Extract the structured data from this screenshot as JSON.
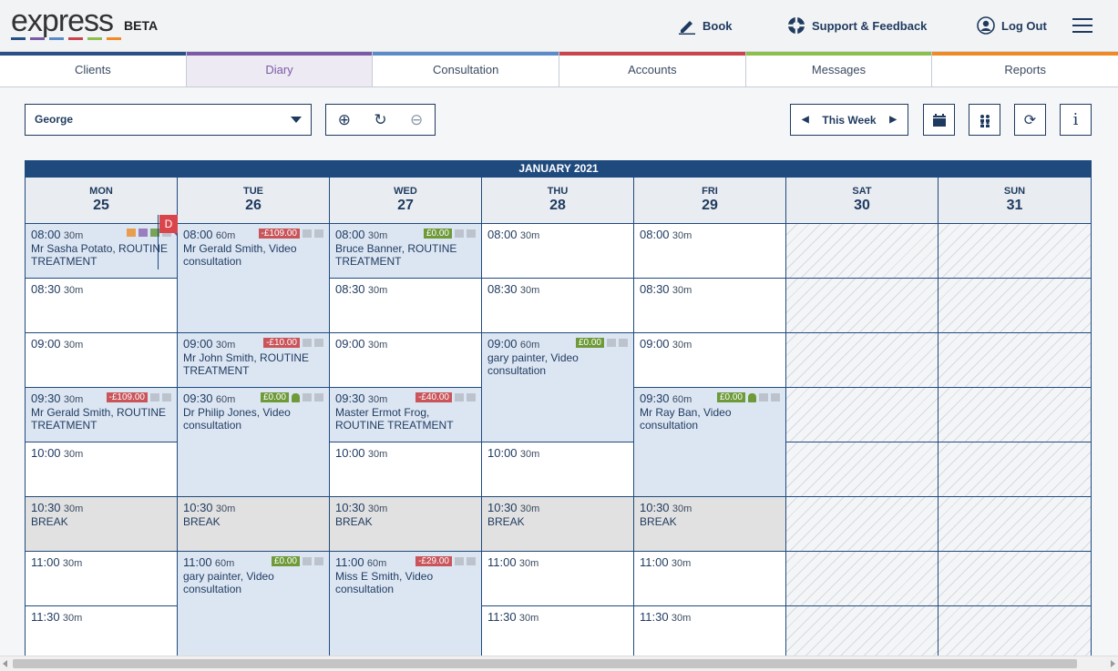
{
  "app": {
    "logo": "express",
    "logo_badge": "BETA",
    "logo_colors": [
      "#2a4f86",
      "#7a5aa6",
      "#5b8cc8",
      "#c9454b",
      "#8cbf4d",
      "#f08a24"
    ]
  },
  "header": {
    "book": "Book",
    "support": "Support & Feedback",
    "logout": "Log Out"
  },
  "tabs": [
    {
      "label": "Clients",
      "color": "#2a4f86"
    },
    {
      "label": "Diary",
      "color": "#7a5aa6"
    },
    {
      "label": "Consultation",
      "color": "#5b8cc8"
    },
    {
      "label": "Accounts",
      "color": "#c9454b"
    },
    {
      "label": "Messages",
      "color": "#8cbf4d"
    },
    {
      "label": "Reports",
      "color": "#f08a24"
    }
  ],
  "toolbar": {
    "practitioner": "George",
    "week_label": "This Week"
  },
  "calendar": {
    "month": "JANUARY 2021",
    "days": [
      {
        "name": "MON",
        "date": "25"
      },
      {
        "name": "TUE",
        "date": "26"
      },
      {
        "name": "WED",
        "date": "27"
      },
      {
        "name": "THU",
        "date": "28"
      },
      {
        "name": "FRI",
        "date": "29"
      },
      {
        "name": "SAT",
        "date": "30"
      },
      {
        "name": "SUN",
        "date": "31"
      }
    ],
    "slots": [
      {
        "day": 0,
        "row": 0,
        "span": 1,
        "time": "08:00",
        "dur": "30m",
        "type": "appt",
        "text": "Mr Sasha Potato, ROUTINE TREATMENT",
        "icons": [
          "c1",
          "c2",
          "c3",
          "g"
        ],
        "corner": true
      },
      {
        "day": 0,
        "row": 1,
        "span": 1,
        "time": "08:30",
        "dur": "30m",
        "type": "free",
        "dbadge": "D"
      },
      {
        "day": 0,
        "row": 2,
        "span": 1,
        "time": "09:00",
        "dur": "30m",
        "type": "free"
      },
      {
        "day": 0,
        "row": 3,
        "span": 1,
        "time": "09:30",
        "dur": "30m",
        "type": "appt",
        "text": "Mr Gerald Smith, ROUTINE TREATMENT",
        "price": "-£109.00",
        "priceType": "neg",
        "icons": [
          "g",
          "g"
        ]
      },
      {
        "day": 0,
        "row": 4,
        "span": 1,
        "time": "10:00",
        "dur": "30m",
        "type": "free"
      },
      {
        "day": 0,
        "row": 5,
        "span": 1,
        "time": "10:30",
        "dur": "30m",
        "type": "brk",
        "text": "BREAK"
      },
      {
        "day": 0,
        "row": 6,
        "span": 1,
        "time": "11:00",
        "dur": "30m",
        "type": "free"
      },
      {
        "day": 0,
        "row": 7,
        "span": 1,
        "time": "11:30",
        "dur": "30m",
        "type": "free"
      },
      {
        "day": 1,
        "row": 0,
        "span": 2,
        "time": "08:00",
        "dur": "60m",
        "type": "appt",
        "text": "Mr Gerald Smith, Video consultation",
        "price": "-£109.00",
        "priceType": "neg",
        "icons": [
          "g",
          "g"
        ]
      },
      {
        "day": 1,
        "row": 2,
        "span": 1,
        "time": "09:00",
        "dur": "30m",
        "type": "appt",
        "text": "Mr John Smith, ROUTINE TREATMENT",
        "price": "-£10.00",
        "priceType": "neg",
        "icons": [
          "g",
          "g"
        ]
      },
      {
        "day": 1,
        "row": 3,
        "span": 2,
        "time": "09:30",
        "dur": "60m",
        "type": "appt",
        "text": "Dr Philip Jones, Video consultation",
        "price": "£0.00",
        "priceType": "pos",
        "icons": [
          "p",
          "g",
          "g"
        ]
      },
      {
        "day": 1,
        "row": 5,
        "span": 1,
        "time": "10:30",
        "dur": "30m",
        "type": "brk",
        "text": "BREAK"
      },
      {
        "day": 1,
        "row": 6,
        "span": 2,
        "time": "11:00",
        "dur": "60m",
        "type": "appt",
        "text": "gary painter, Video consultation",
        "price": "£0.00",
        "priceType": "pos",
        "icons": [
          "g",
          "g"
        ]
      },
      {
        "day": 2,
        "row": 0,
        "span": 1,
        "time": "08:00",
        "dur": "30m",
        "type": "appt",
        "text": "Bruce Banner, ROUTINE TREATMENT",
        "price": "£0.00",
        "priceType": "pos",
        "icons": [
          "g",
          "g"
        ]
      },
      {
        "day": 2,
        "row": 1,
        "span": 1,
        "time": "08:30",
        "dur": "30m",
        "type": "free"
      },
      {
        "day": 2,
        "row": 2,
        "span": 1,
        "time": "09:00",
        "dur": "30m",
        "type": "free"
      },
      {
        "day": 2,
        "row": 3,
        "span": 1,
        "time": "09:30",
        "dur": "30m",
        "type": "appt",
        "text": "Master Ermot Frog, ROUTINE TREATMENT",
        "price": "-£40.00",
        "priceType": "neg",
        "icons": [
          "g",
          "g"
        ]
      },
      {
        "day": 2,
        "row": 4,
        "span": 1,
        "time": "10:00",
        "dur": "30m",
        "type": "free"
      },
      {
        "day": 2,
        "row": 5,
        "span": 1,
        "time": "10:30",
        "dur": "30m",
        "type": "brk",
        "text": "BREAK"
      },
      {
        "day": 2,
        "row": 6,
        "span": 2,
        "time": "11:00",
        "dur": "60m",
        "type": "appt",
        "text": "Miss E Smith, Video consultation",
        "price": "-£29.00",
        "priceType": "neg",
        "icons": [
          "g",
          "g"
        ]
      },
      {
        "day": 3,
        "row": 0,
        "span": 1,
        "time": "08:00",
        "dur": "30m",
        "type": "free"
      },
      {
        "day": 3,
        "row": 1,
        "span": 1,
        "time": "08:30",
        "dur": "30m",
        "type": "free"
      },
      {
        "day": 3,
        "row": 2,
        "span": 2,
        "time": "09:00",
        "dur": "60m",
        "type": "appt",
        "text": "gary painter, Video consultation",
        "price": "£0.00",
        "priceType": "pos",
        "icons": [
          "g",
          "g"
        ]
      },
      {
        "day": 3,
        "row": 4,
        "span": 1,
        "time": "10:00",
        "dur": "30m",
        "type": "free"
      },
      {
        "day": 3,
        "row": 5,
        "span": 1,
        "time": "10:30",
        "dur": "30m",
        "type": "brk",
        "text": "BREAK"
      },
      {
        "day": 3,
        "row": 6,
        "span": 1,
        "time": "11:00",
        "dur": "30m",
        "type": "free"
      },
      {
        "day": 3,
        "row": 7,
        "span": 1,
        "time": "11:30",
        "dur": "30m",
        "type": "free"
      },
      {
        "day": 4,
        "row": 0,
        "span": 1,
        "time": "08:00",
        "dur": "30m",
        "type": "free"
      },
      {
        "day": 4,
        "row": 1,
        "span": 1,
        "time": "08:30",
        "dur": "30m",
        "type": "free"
      },
      {
        "day": 4,
        "row": 2,
        "span": 1,
        "time": "09:00",
        "dur": "30m",
        "type": "free"
      },
      {
        "day": 4,
        "row": 3,
        "span": 2,
        "time": "09:30",
        "dur": "60m",
        "type": "appt",
        "text": "Mr Ray Ban, Video consultation",
        "price": "£0.00",
        "priceType": "pos",
        "icons": [
          "p",
          "g",
          "g"
        ]
      },
      {
        "day": 4,
        "row": 5,
        "span": 1,
        "time": "10:30",
        "dur": "30m",
        "type": "brk",
        "text": "BREAK"
      },
      {
        "day": 4,
        "row": 6,
        "span": 1,
        "time": "11:00",
        "dur": "30m",
        "type": "free"
      },
      {
        "day": 4,
        "row": 7,
        "span": 1,
        "time": "11:30",
        "dur": "30m",
        "type": "free"
      }
    ]
  }
}
